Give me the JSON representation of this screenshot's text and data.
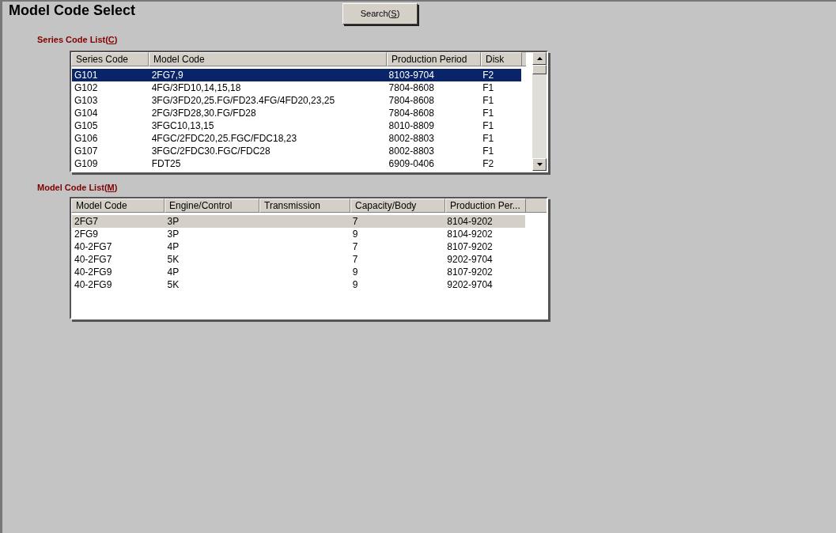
{
  "title": "Model Code Select",
  "search_button": {
    "before": "Search(",
    "mnemonic": "S",
    "after": ")"
  },
  "series_list": {
    "label": {
      "before": "Series Code List(",
      "mnemonic": "C",
      "after": ")"
    },
    "columns": [
      "Series Code",
      "Model Code",
      "Production Period",
      "Disk"
    ],
    "rows": [
      {
        "cells": [
          "G101",
          "2FG7,9",
          "8103-9704",
          "F2"
        ],
        "selected": true
      },
      {
        "cells": [
          "G102",
          "4FG/3FD10,14,15,18",
          "7804-8608",
          "F1"
        ],
        "selected": false
      },
      {
        "cells": [
          "G103",
          "3FG/3FD20,25.FG/FD23.4FG/4FD20,23,25",
          "7804-8608",
          "F1"
        ],
        "selected": false
      },
      {
        "cells": [
          "G104",
          "2FG/3FD28,30.FG/FD28",
          "7804-8608",
          "F1"
        ],
        "selected": false
      },
      {
        "cells": [
          "G105",
          "3FGC10,13,15",
          "8010-8809",
          "F1"
        ],
        "selected": false
      },
      {
        "cells": [
          "G106",
          "4FGC/2FDC20,25.FGC/FDC18,23",
          "8002-8803",
          "F1"
        ],
        "selected": false
      },
      {
        "cells": [
          "G107",
          "3FGC/2FDC30.FGC/FDC28",
          "8002-8803",
          "F1"
        ],
        "selected": false
      },
      {
        "cells": [
          "G109",
          "FDT25",
          "6909-0406",
          "F2"
        ],
        "selected": false
      }
    ]
  },
  "model_list": {
    "label": {
      "before": "Model Code List(",
      "mnemonic": "M",
      "after": ")"
    },
    "columns": [
      "Model Code",
      "Engine/Control",
      "Transmission",
      "Capacity/Body",
      "Production Per..."
    ],
    "rows": [
      {
        "cells": [
          "2FG7",
          "3P",
          "",
          "7",
          "8104-9202"
        ],
        "selected": true
      },
      {
        "cells": [
          "2FG9",
          "3P",
          "",
          "9",
          "8104-9202"
        ],
        "selected": false
      },
      {
        "cells": [
          "40-2FG7",
          "4P",
          "",
          "7",
          "8107-9202"
        ],
        "selected": false
      },
      {
        "cells": [
          "40-2FG7",
          "5K",
          "",
          "7",
          "9202-9704"
        ],
        "selected": false
      },
      {
        "cells": [
          "40-2FG9",
          "4P",
          "",
          "9",
          "8107-9202"
        ],
        "selected": false
      },
      {
        "cells": [
          "40-2FG9",
          "5K",
          "",
          "9",
          "9202-9704"
        ],
        "selected": false
      }
    ]
  }
}
